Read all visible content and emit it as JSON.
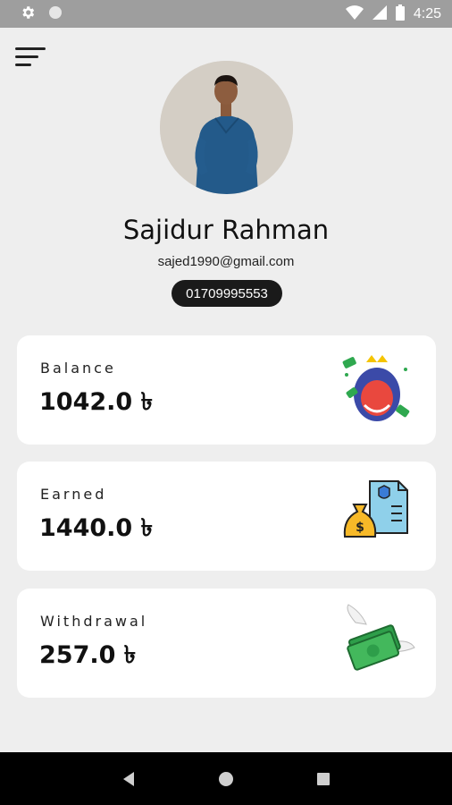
{
  "status_bar": {
    "time": "4:25",
    "icons": [
      "gear-icon",
      "circle-icon",
      "wifi-icon",
      "signal-icon",
      "battery-icon"
    ]
  },
  "profile": {
    "name": "Sajidur Rahman",
    "email": "sajed1990@gmail.com",
    "phone": "01709995553"
  },
  "cards": [
    {
      "label": "Balance",
      "value": "1042.0 ৳",
      "icon": "money-bag-icon"
    },
    {
      "label": "Earned",
      "value": "1440.0 ৳",
      "icon": "document-money-icon"
    },
    {
      "label": "Withdrawal",
      "value": "257.0 ৳",
      "icon": "flying-money-icon"
    }
  ],
  "nav": {
    "icons": [
      "back-icon",
      "home-icon",
      "recents-icon"
    ]
  },
  "colors": {
    "background": "#eeeeee",
    "card": "#ffffff",
    "status_bar": "#9e9e9e",
    "pill": "#1a1a1a"
  }
}
